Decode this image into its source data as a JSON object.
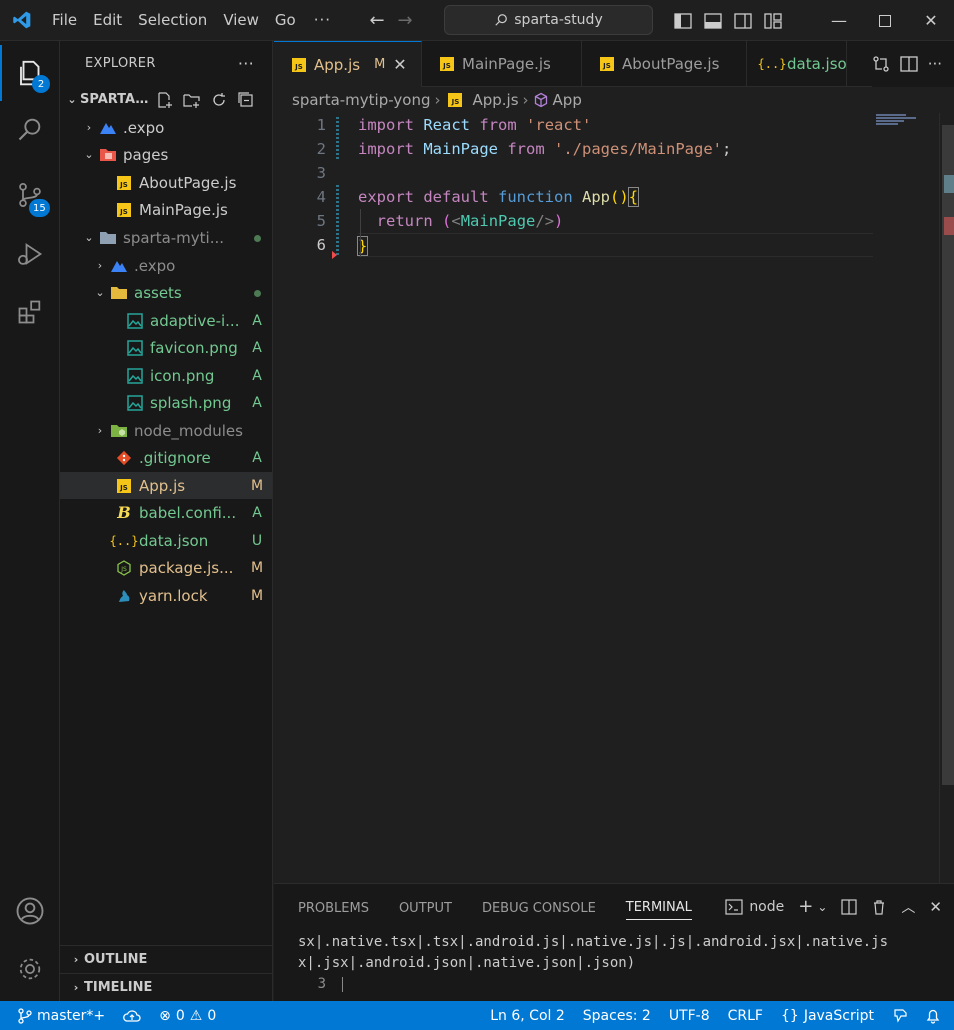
{
  "titlebar": {
    "menus": [
      "File",
      "Edit",
      "Selection",
      "View",
      "Go"
    ],
    "more": "···",
    "search": "sparta-study"
  },
  "activity": {
    "explorer_badge": "2",
    "scm_badge": "15"
  },
  "sidebar": {
    "title": "EXPLORER",
    "more": "···",
    "root": "SPARTA...",
    "tree": [
      {
        "name": ".expo",
        "status": ""
      },
      {
        "name": "pages",
        "status": ""
      },
      {
        "name": "AboutPage.js",
        "status": ""
      },
      {
        "name": "MainPage.js",
        "status": ""
      },
      {
        "name": "sparta-myti...",
        "status": ""
      },
      {
        "name": ".expo",
        "status": ""
      },
      {
        "name": "assets",
        "status": ""
      },
      {
        "name": "adaptive-i...",
        "status": "A"
      },
      {
        "name": "favicon.png",
        "status": "A"
      },
      {
        "name": "icon.png",
        "status": "A"
      },
      {
        "name": "splash.png",
        "status": "A"
      },
      {
        "name": "node_modules",
        "status": ""
      },
      {
        "name": ".gitignore",
        "status": "A"
      },
      {
        "name": "App.js",
        "status": "M"
      },
      {
        "name": "babel.confi...",
        "status": "A"
      },
      {
        "name": "data.json",
        "status": "U"
      },
      {
        "name": "package.js...",
        "status": "M"
      },
      {
        "name": "yarn.lock",
        "status": "M"
      }
    ],
    "outline": "OUTLINE",
    "timeline": "TIMELINE"
  },
  "tabs": [
    {
      "label": "App.js",
      "mod": "M"
    },
    {
      "label": "MainPage.js"
    },
    {
      "label": "AboutPage.js"
    },
    {
      "label": "data.jso"
    }
  ],
  "breadcrumb": [
    "sparta-mytip-yong",
    "App.js",
    "App"
  ],
  "code": {
    "line_numbers": [
      "1",
      "2",
      "3",
      "4",
      "5",
      "6"
    ]
  },
  "panel": {
    "tabs": [
      "PROBLEMS",
      "OUTPUT",
      "DEBUG CONSOLE",
      "TERMINAL"
    ],
    "shell": "node",
    "line1": "sx|.native.tsx|.tsx|.android.js|.native.js|.js|.android.jsx|.native.js",
    "line2": "x|.jsx|.android.json|.native.json|.json)",
    "line3_num": "3"
  },
  "statusbar": {
    "branch": "master*+",
    "errors": "0",
    "warnings": "0",
    "position": "Ln 6, Col 2",
    "spaces": "Spaces: 2",
    "encoding": "UTF-8",
    "eol": "CRLF",
    "language": "JavaScript"
  }
}
